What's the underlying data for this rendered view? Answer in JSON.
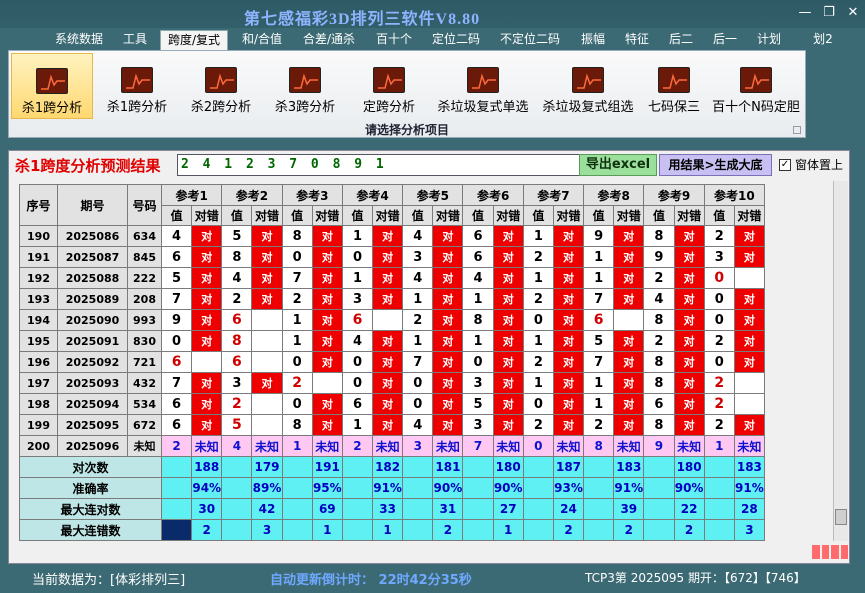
{
  "window": {
    "title": "第七感福彩3D排列三软件V8.80",
    "minimize": "—",
    "restore": "❐",
    "close": "✕"
  },
  "menu": [
    "系统数据",
    "工具",
    "跨度/复式",
    "和/合值",
    "合差/通杀",
    "百十个",
    "定位二码",
    "不定位二码",
    "振幅",
    "特征",
    "后二",
    "后一",
    "计划",
    "划2"
  ],
  "ribbon": {
    "title": "请选择分析项目",
    "buttons": [
      "杀1跨分析",
      "杀1跨分析",
      "杀2跨分析",
      "杀3跨分析",
      "定跨分析",
      "杀垃圾复式单选",
      "杀垃圾复式组选",
      "七码保三",
      "百十个N码定胆"
    ]
  },
  "result": {
    "title": "杀1跨度分析预测结果",
    "numbers": "2 4 1 2 3 7 0 8 9 1",
    "excel_button": "导出excel",
    "gen_button": "用结果>生成大底",
    "pin_label": "窗体置上"
  },
  "table": {
    "headers": {
      "seq": "序号",
      "period": "期号",
      "code": "号码",
      "refs": [
        "参考1",
        "参考2",
        "参考3",
        "参考4",
        "参考5",
        "参考6",
        "参考7",
        "参考8",
        "参考9",
        "参考10"
      ],
      "value": "值",
      "verdict": "对错"
    },
    "rows": [
      {
        "seq": "190",
        "period": "2025086",
        "code": "634",
        "v": [
          "4",
          "5",
          "8",
          "1",
          "4",
          "6",
          "1",
          "9",
          "8",
          "2"
        ],
        "d": [
          "对",
          "对",
          "对",
          "对",
          "对",
          "对",
          "对",
          "对",
          "对",
          "对"
        ],
        "red": []
      },
      {
        "seq": "191",
        "period": "2025087",
        "code": "845",
        "v": [
          "6",
          "8",
          "0",
          "0",
          "3",
          "6",
          "2",
          "1",
          "9",
          "3"
        ],
        "d": [
          "对",
          "对",
          "对",
          "对",
          "对",
          "对",
          "对",
          "对",
          "对",
          "对"
        ],
        "red": []
      },
      {
        "seq": "192",
        "period": "2025088",
        "code": "222",
        "v": [
          "5",
          "4",
          "7",
          "1",
          "4",
          "4",
          "1",
          "1",
          "2",
          "0"
        ],
        "d": [
          "对",
          "对",
          "对",
          "对",
          "对",
          "对",
          "对",
          "对",
          "对",
          ""
        ],
        "red": [
          9
        ]
      },
      {
        "seq": "193",
        "period": "2025089",
        "code": "208",
        "v": [
          "7",
          "2",
          "2",
          "3",
          "1",
          "1",
          "2",
          "7",
          "4",
          "0"
        ],
        "d": [
          "对",
          "对",
          "对",
          "对",
          "对",
          "对",
          "对",
          "对",
          "对",
          "对"
        ],
        "red": []
      },
      {
        "seq": "194",
        "period": "2025090",
        "code": "993",
        "v": [
          "9",
          "6",
          "1",
          "6",
          "2",
          "8",
          "0",
          "6",
          "8",
          "0"
        ],
        "d": [
          "对",
          "",
          "对",
          "",
          "对",
          "对",
          "对",
          "",
          "对",
          "对"
        ],
        "red": [
          1,
          3,
          7
        ]
      },
      {
        "seq": "195",
        "period": "2025091",
        "code": "830",
        "v": [
          "0",
          "8",
          "1",
          "4",
          "1",
          "1",
          "1",
          "5",
          "2",
          "2"
        ],
        "d": [
          "对",
          "",
          "对",
          "对",
          "对",
          "对",
          "对",
          "对",
          "对",
          "对"
        ],
        "red": [
          1
        ]
      },
      {
        "seq": "196",
        "period": "2025092",
        "code": "721",
        "v": [
          "6",
          "6",
          "0",
          "0",
          "7",
          "0",
          "2",
          "7",
          "8",
          "0"
        ],
        "d": [
          "",
          "",
          "对",
          "对",
          "对",
          "对",
          "对",
          "对",
          "对",
          "对"
        ],
        "red": [
          0,
          1
        ]
      },
      {
        "seq": "197",
        "period": "2025093",
        "code": "432",
        "v": [
          "7",
          "3",
          "2",
          "0",
          "0",
          "3",
          "1",
          "1",
          "8",
          "2"
        ],
        "d": [
          "对",
          "对",
          "",
          "对",
          "对",
          "对",
          "对",
          "对",
          "对",
          ""
        ],
        "red": [
          2,
          9
        ]
      },
      {
        "seq": "198",
        "period": "2025094",
        "code": "534",
        "v": [
          "6",
          "2",
          "0",
          "6",
          "0",
          "5",
          "0",
          "1",
          "6",
          "2"
        ],
        "d": [
          "对",
          "",
          "对",
          "对",
          "对",
          "对",
          "对",
          "对",
          "对",
          ""
        ],
        "red": [
          1,
          9
        ]
      },
      {
        "seq": "199",
        "period": "2025095",
        "code": "672",
        "v": [
          "6",
          "5",
          "8",
          "1",
          "4",
          "3",
          "2",
          "2",
          "8",
          "2"
        ],
        "d": [
          "对",
          "",
          "对",
          "对",
          "对",
          "对",
          "对",
          "对",
          "对",
          "对"
        ],
        "red": [
          1
        ]
      }
    ],
    "pending": {
      "seq": "200",
      "period": "2025096",
      "code": "未知",
      "v": [
        "2",
        "4",
        "1",
        "2",
        "3",
        "7",
        "0",
        "8",
        "9",
        "1"
      ],
      "unknown": "未知"
    },
    "stats": [
      {
        "label": "对次数",
        "values": [
          "188",
          "179",
          "191",
          "182",
          "181",
          "180",
          "187",
          "183",
          "180",
          "183"
        ]
      },
      {
        "label": "准确率",
        "values": [
          "94%",
          "89%",
          "95%",
          "91%",
          "90%",
          "90%",
          "93%",
          "91%",
          "90%",
          "91%"
        ]
      },
      {
        "label": "最大连对数",
        "values": [
          "30",
          "42",
          "69",
          "33",
          "31",
          "27",
          "24",
          "39",
          "22",
          "28"
        ]
      },
      {
        "label": "最大连错数",
        "values": [
          "2",
          "3",
          "1",
          "1",
          "2",
          "1",
          "2",
          "2",
          "2",
          "3"
        ]
      }
    ]
  },
  "footer": {
    "current": "当前数据为：[体彩排列三]",
    "countdown": "自动更新倒计时：  22时42分35秒",
    "draw": "TCP3第 2025095 期开：【672】【746】"
  }
}
